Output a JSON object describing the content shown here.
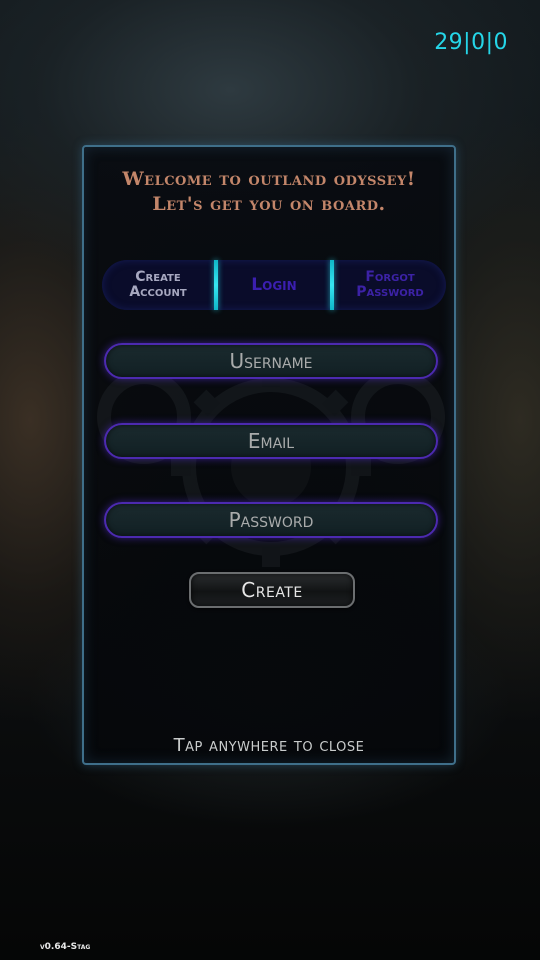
{
  "hud": {
    "fps_readout": "29|0|0",
    "version": "v0.64-Stag"
  },
  "dialog": {
    "welcome_line1": "Welcome to outland odyssey!",
    "welcome_line2": "Let's get you on board.",
    "tabs": [
      {
        "line1": "Create",
        "line2": "Account",
        "selected": true
      },
      {
        "line1": "Login",
        "line2": "",
        "selected": false
      },
      {
        "line1": "Forgot",
        "line2": "Password",
        "selected": false
      }
    ],
    "fields": {
      "username": {
        "value": "",
        "placeholder": "Username"
      },
      "email": {
        "value": "",
        "placeholder": "Email"
      },
      "password": {
        "value": "",
        "placeholder": "Password"
      }
    },
    "create_label": "Create",
    "close_hint": "Tap anywhere to close"
  },
  "colors": {
    "fps_text": "#25d6e8",
    "welcome_text": "#c3866a",
    "tab_divider": "#37e6f2",
    "field_glow": "#4c2ab0",
    "panel_border": "#3f6f8a"
  },
  "icons": {
    "background_decoration": "gear-icon"
  }
}
